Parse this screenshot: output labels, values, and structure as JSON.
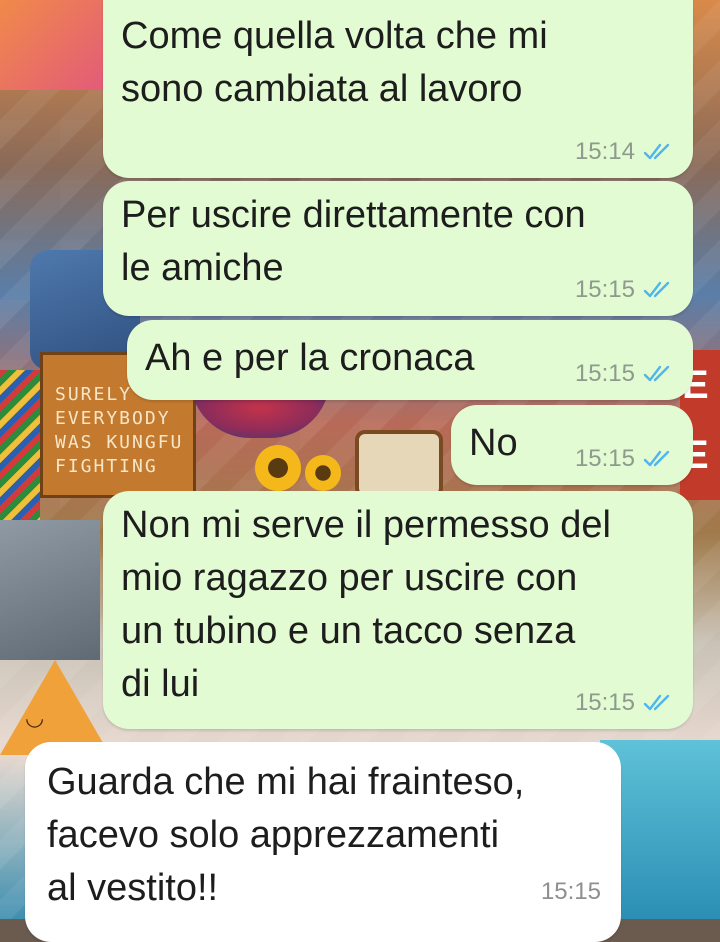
{
  "colors": {
    "outgoing_bubble": "#e2fbd2",
    "incoming_bubble": "#ffffff",
    "read_ticks": "#4fb6ec",
    "timestamp": "#8d9a8d"
  },
  "wallpaper": {
    "board_lines": [
      "SURELY",
      "EVERYBODY",
      "WAS KUNGFU",
      "FIGHTING"
    ],
    "poster_letters": [
      "E",
      "E"
    ]
  },
  "messages": [
    {
      "direction": "outgoing",
      "text": "Come quella volta che mi\nsono cambiata al lavoro",
      "time": "15:14",
      "status_icon": "double-check-read-icon"
    },
    {
      "direction": "outgoing",
      "text": "Per uscire direttamente con\nle amiche",
      "time": "15:15",
      "status_icon": "double-check-read-icon"
    },
    {
      "direction": "outgoing",
      "text": "Ah e per la cronaca",
      "time": "15:15",
      "status_icon": "double-check-read-icon"
    },
    {
      "direction": "outgoing",
      "text": "No",
      "time": "15:15",
      "status_icon": "double-check-read-icon"
    },
    {
      "direction": "outgoing",
      "text": "Non mi serve il permesso del\nmio ragazzo per uscire con\nun tubino e un tacco senza\ndi lui",
      "time": "15:15",
      "status_icon": "double-check-read-icon"
    },
    {
      "direction": "incoming",
      "text": "Guarda che mi hai frainteso,\nfacevo solo apprezzamenti\nal vestito!!",
      "time": "15:15"
    }
  ]
}
